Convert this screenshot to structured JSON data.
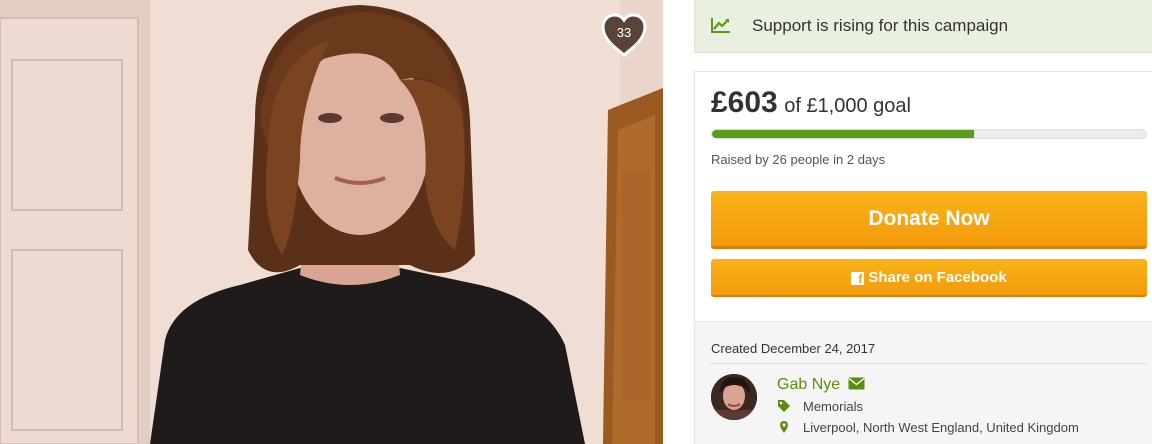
{
  "photo": {
    "alt_subject": "campaign-photo",
    "like_count": "33"
  },
  "rising_banner": {
    "icon": "trending-up-icon",
    "text": "Support is rising for this campaign"
  },
  "donation": {
    "raised": "£603",
    "goal_text": "of £1,000 goal",
    "progress_fraction": 0.603,
    "raised_by": "Raised by 26 people in 2 days",
    "donate_label": "Donate Now",
    "share_label": "Share on Facebook",
    "share_icon": "facebook-icon"
  },
  "organizer": {
    "created": "Created December 24, 2017",
    "name": "Gab Nye",
    "contact_icon": "envelope-icon",
    "category": "Memorials",
    "category_icon": "tag-icon",
    "location": "Liverpool, North West England, United Kingdom",
    "location_icon": "map-pin-icon"
  },
  "colors": {
    "accent_green": "#5a9b17",
    "donate_orange": "#f5a312",
    "banner_bg": "#e9f0e2",
    "link_green": "#5c8d0f"
  }
}
